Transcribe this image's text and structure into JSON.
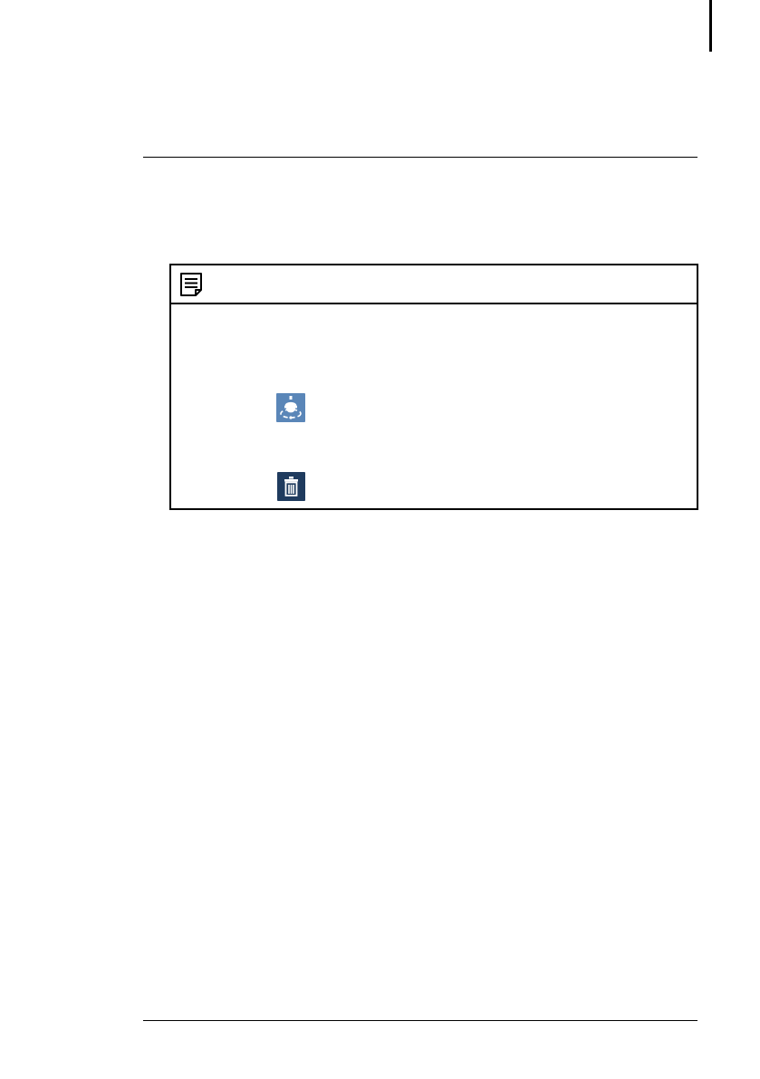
{
  "page": {
    "edge_mark_color": "#000000",
    "rule_color": "#000000"
  },
  "note": {
    "icon": "note-icon",
    "border_color": "#000000",
    "rows": [
      {
        "icon": "ptz-camera-icon",
        "tile_color": "#5a86b8"
      },
      {
        "icon": "trash-icon",
        "tile_color": "#1f3b5e"
      }
    ]
  }
}
